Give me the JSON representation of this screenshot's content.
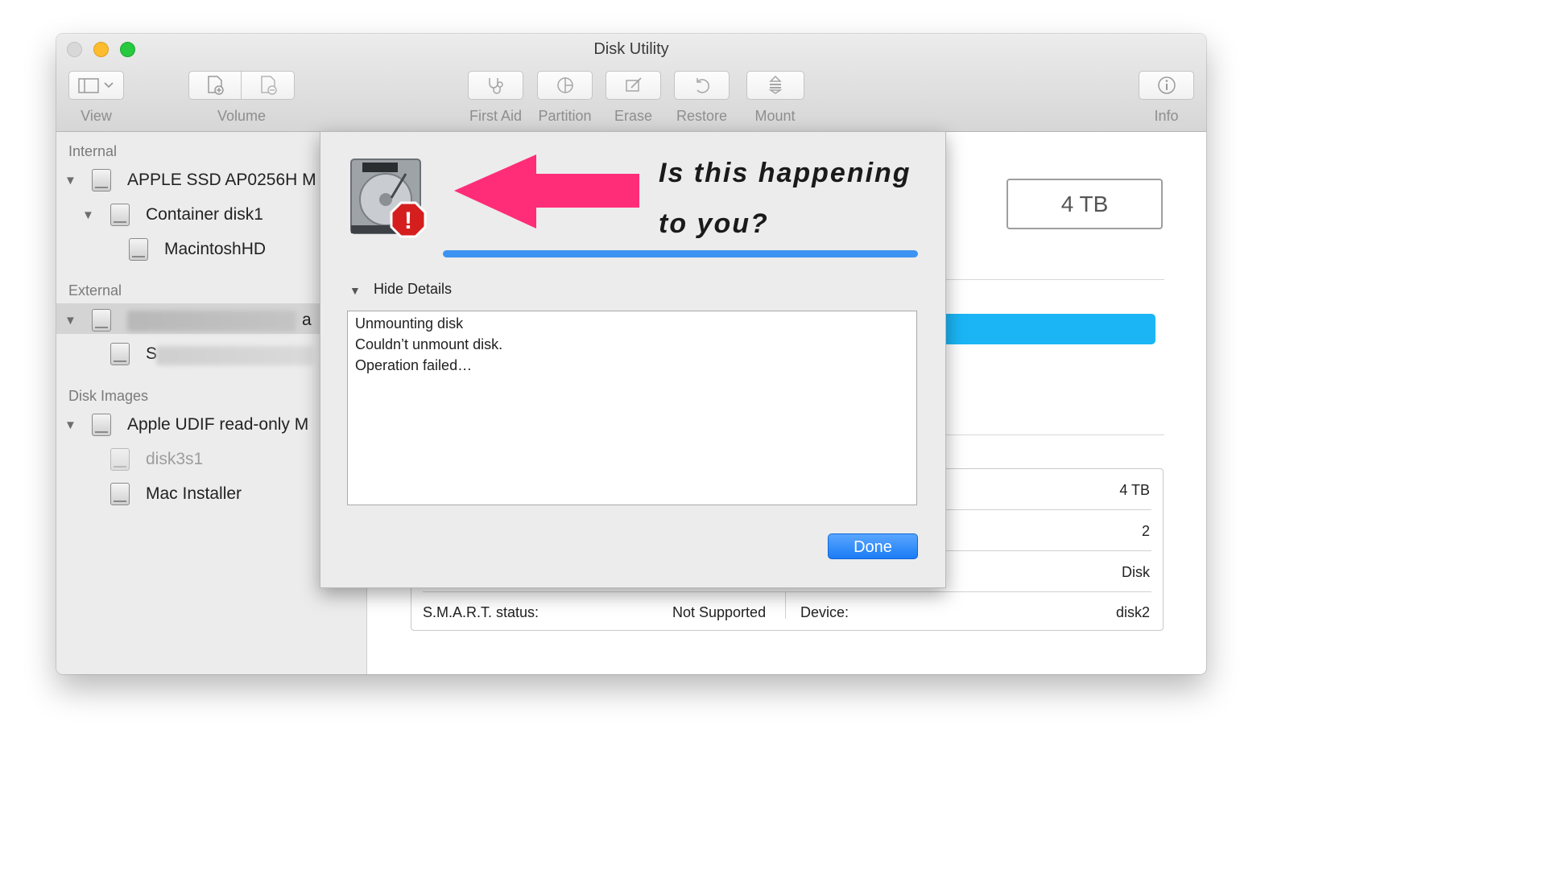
{
  "window": {
    "title": "Disk Utility"
  },
  "toolbar": {
    "view_label": "View",
    "volume_label": "Volume",
    "first_aid_label": "First Aid",
    "partition_label": "Partition",
    "erase_label": "Erase",
    "restore_label": "Restore",
    "mount_label": "Mount",
    "info_label": "Info"
  },
  "sidebar": {
    "internal_header": "Internal",
    "internal_disk": "APPLE SSD AP0256H M",
    "container": "Container disk1",
    "volume": "MacintoshHD",
    "external_header": "External",
    "external_disk_tail": "a",
    "external_volume_first": "S",
    "disk_images_header": "Disk Images",
    "image_disk": "Apple UDIF read-only M",
    "image_volume_dim": "disk3s1",
    "image_volume": "Mac Installer"
  },
  "main": {
    "capacity_badge": "4 TB",
    "info_values": [
      "4 TB",
      "2",
      "Disk"
    ],
    "smart_label": "S.M.A.R.T. status:",
    "smart_value": "Not Supported",
    "device_label": "Device:",
    "device_value": "disk2",
    "usage_bar_color": "#1bb5f5"
  },
  "dialog": {
    "headline_line1": "Is this happening",
    "headline_line2": "to you?",
    "hide_details_label": "Hide Details",
    "details_lines": [
      "Unmounting disk",
      "Couldn’t unmount disk.",
      "Operation failed…"
    ],
    "done_label": "Done",
    "arrow_color": "#ff2d78",
    "progress_color": "#3d93f2"
  }
}
